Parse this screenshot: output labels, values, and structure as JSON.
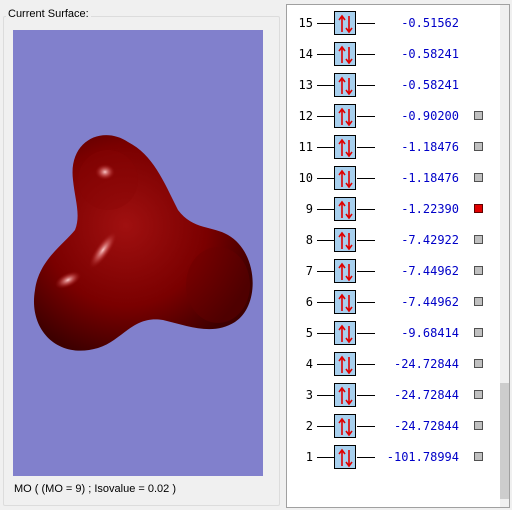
{
  "surface_panel": {
    "title": "Current Surface:",
    "status": "MO ( (MO = 9) ; Isovalue = 0.02 )"
  },
  "colors": {
    "viewport_background": "#8180cc",
    "surface": "#7a0000",
    "orbital_box": "#a8d0ee",
    "energy_text": "#0000c8",
    "selected_checkbox": "#e00000"
  },
  "orbitals": [
    {
      "num": "15",
      "energy": "-0.51562",
      "checkbox": "none"
    },
    {
      "num": "14",
      "energy": "-0.58241",
      "checkbox": "none"
    },
    {
      "num": "13",
      "energy": "-0.58241",
      "checkbox": "none"
    },
    {
      "num": "12",
      "energy": "-0.90200",
      "checkbox": "unselected"
    },
    {
      "num": "11",
      "energy": "-1.18476",
      "checkbox": "unselected"
    },
    {
      "num": "10",
      "energy": "-1.18476",
      "checkbox": "unselected"
    },
    {
      "num": "9",
      "energy": "-1.22390",
      "checkbox": "selected"
    },
    {
      "num": "8",
      "energy": "-7.42922",
      "checkbox": "unselected"
    },
    {
      "num": "7",
      "energy": "-7.44962",
      "checkbox": "unselected"
    },
    {
      "num": "6",
      "energy": "-7.44962",
      "checkbox": "unselected"
    },
    {
      "num": "5",
      "energy": "-9.68414",
      "checkbox": "unselected"
    },
    {
      "num": "4",
      "energy": "-24.72844",
      "checkbox": "unselected"
    },
    {
      "num": "3",
      "energy": "-24.72844",
      "checkbox": "unselected"
    },
    {
      "num": "2",
      "energy": "-24.72844",
      "checkbox": "unselected"
    },
    {
      "num": "1",
      "energy": "-101.78994",
      "checkbox": "unselected"
    }
  ]
}
